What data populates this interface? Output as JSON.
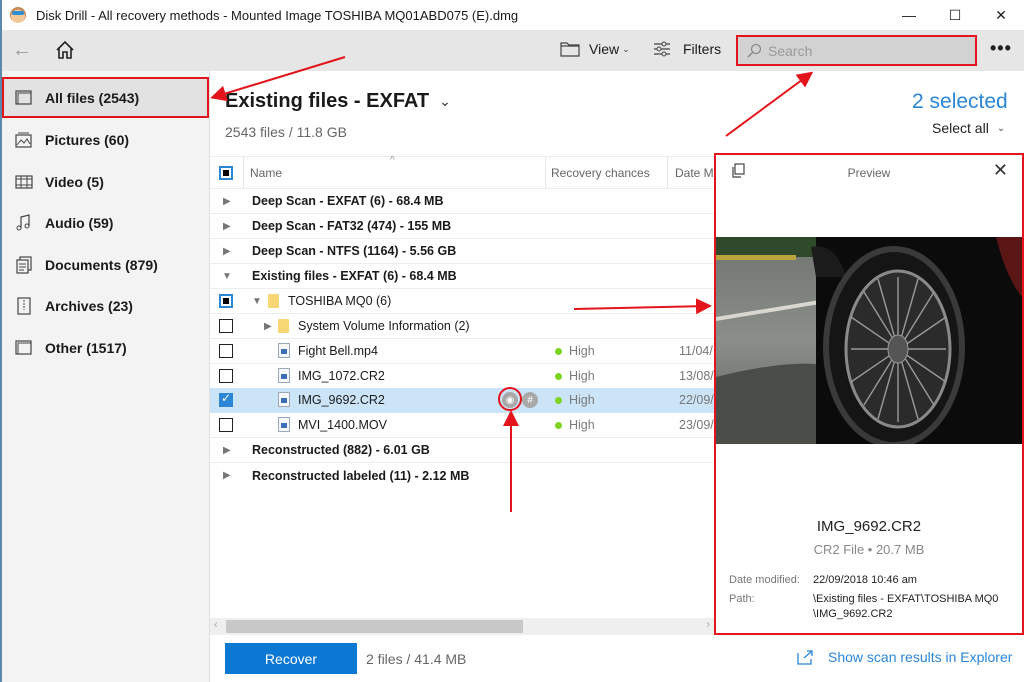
{
  "window": {
    "title": "Disk Drill - All recovery methods - Mounted Image TOSHIBA MQ01ABD075 (E).dmg",
    "controls": {
      "minimize": "—",
      "maximize": "☐",
      "close": "✕"
    }
  },
  "toolbar": {
    "back_icon": "←",
    "view_label": "View",
    "filters_label": "Filters",
    "search_placeholder": "Search",
    "search_value": "",
    "more_label": "•••"
  },
  "sidebar": {
    "items": [
      {
        "label": "All files (2543)",
        "icon": "all-files-icon",
        "active": true
      },
      {
        "label": "Pictures (60)",
        "icon": "pictures-icon",
        "active": false
      },
      {
        "label": "Video (5)",
        "icon": "video-icon",
        "active": false
      },
      {
        "label": "Audio (59)",
        "icon": "audio-icon",
        "active": false
      },
      {
        "label": "Documents (879)",
        "icon": "documents-icon",
        "active": false
      },
      {
        "label": "Archives (23)",
        "icon": "archives-icon",
        "active": false
      },
      {
        "label": "Other (1517)",
        "icon": "other-icon",
        "active": false
      }
    ]
  },
  "main": {
    "title": "Existing files - EXFAT",
    "subtitle": "2543 files / 11.8 GB",
    "selected_count": "2 selected",
    "select_all_label": "Select all"
  },
  "table": {
    "columns": {
      "name": "Name",
      "recovery": "Recovery chances",
      "date": "Date M"
    },
    "rows": [
      {
        "type": "group",
        "label": "Deep Scan - EXFAT (6) - 68.4 MB",
        "expanded": false
      },
      {
        "type": "group",
        "label": "Deep Scan - FAT32 (474) - 155 MB",
        "expanded": false
      },
      {
        "type": "group",
        "label": "Deep Scan - NTFS (1164) - 5.56 GB",
        "expanded": false
      },
      {
        "type": "group",
        "label": "Existing files - EXFAT (6) - 68.4 MB",
        "expanded": true
      },
      {
        "type": "folder",
        "label": "TOSHIBA MQ0 (6)",
        "checked": "partial",
        "expanded": true
      },
      {
        "type": "folder",
        "label": "System Volume Information (2)",
        "checked": "unchecked",
        "expanded": false
      },
      {
        "type": "file",
        "label": "Fight Bell.mp4",
        "checked": "unchecked",
        "recovery": "High",
        "date": "11/04/"
      },
      {
        "type": "file",
        "label": "IMG_1072.CR2",
        "checked": "unchecked",
        "recovery": "High",
        "date": "13/08/"
      },
      {
        "type": "file",
        "label": "IMG_9692.CR2",
        "checked": "checked",
        "recovery": "High",
        "date": "22/09/",
        "selected": true
      },
      {
        "type": "file",
        "label": "MVI_1400.MOV",
        "checked": "unchecked",
        "recovery": "High",
        "date": "23/09/"
      },
      {
        "type": "group",
        "label": "Reconstructed (882) - 6.01 GB",
        "expanded": false
      },
      {
        "type": "group",
        "label": "Reconstructed labeled (11) - 2.12 MB",
        "expanded": false
      }
    ],
    "row_actions": {
      "preview_icon": "◉",
      "hash_icon": "#"
    }
  },
  "preview": {
    "title": "Preview",
    "close_icon": "✕",
    "file_name": "IMG_9692.CR2",
    "file_type": "CR2 File • 20.7 MB",
    "date_label": "Date modified:",
    "date_value": "22/09/2018 10:46 am",
    "path_label": "Path:",
    "path_line1": "\\Existing files - EXFAT\\TOSHIBA MQ0",
    "path_line2": "\\IMG_9692.CR2"
  },
  "bottom": {
    "recover_label": "Recover",
    "info": "2 files / 41.4 MB",
    "explorer_link": "Show scan results in Explorer"
  },
  "colors": {
    "accent": "#0b78d4",
    "link": "#2b86d6",
    "annotation": "#e3141b",
    "recovery_high": "#7ed321",
    "selection": "#cce4f7"
  }
}
